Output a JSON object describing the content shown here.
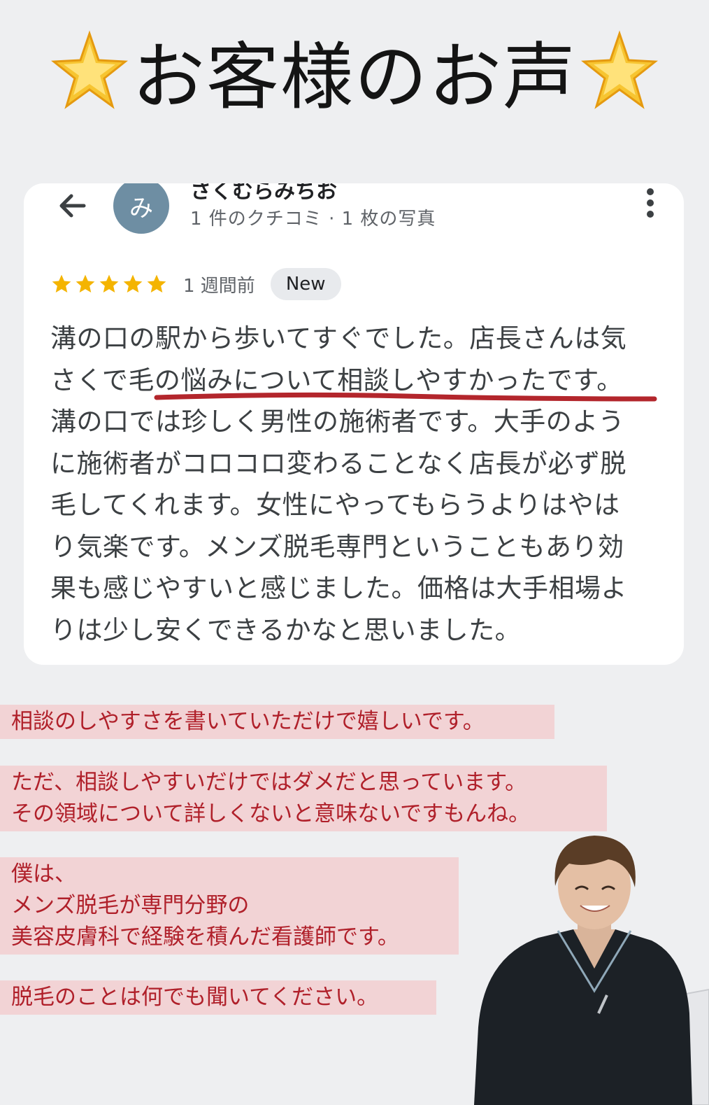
{
  "header": {
    "title": "お客様のお声",
    "left_icon": "glowing-star-icon",
    "right_icon": "glowing-star-icon"
  },
  "review": {
    "back_icon": "arrow-back-icon",
    "avatar_initial": "み",
    "reviewer_name": "さくむらみちお",
    "reviewer_meta": "1 件のクチコミ · 1 枚の写真",
    "menu_icon": "more-vert-icon",
    "rating": 5,
    "rating_max": 5,
    "time_ago": "1 週間前",
    "badge": "New",
    "body_lines": [
      "溝の口の駅から歩いてすぐでした。店長さんは気",
      "さくで毛の悩みについて相談しやすかったです。",
      "溝の口では珍しく男性の施術者です。大手のよう",
      "に施術者がコロコロ変わることなく店長が必ず脱",
      "毛してくれます。女性にやってもらうよりはやは",
      "り気楽です。メンズ脱毛専門ということもあり効",
      "果も感じやすいと感じました。価格は大手相場よ",
      "りは少し安くできるかなと思いました。"
    ]
  },
  "commentary": {
    "note1": "相談のしやすさを書いていただけで嬉しいです。",
    "note2_line1": "ただ、相談しやすいだけではダメだと思っています。",
    "note2_line2": "その領域について詳しくないと意味ないですもんね。",
    "note3_line1": "僕は、",
    "note3_line2": "メンズ脱毛が専門分野の",
    "note3_line3": "美容皮膚科で経験を積んだ看護師です。",
    "note4": "脱毛のことは何でも聞いてください。"
  },
  "colors": {
    "background": "#eeeff1",
    "card": "#ffffff",
    "star": "#f4b400",
    "underline": "#b3262c",
    "note_bg": "#f2d3d5",
    "note_text": "#b0202a",
    "avatar": "#6e8ea3"
  }
}
